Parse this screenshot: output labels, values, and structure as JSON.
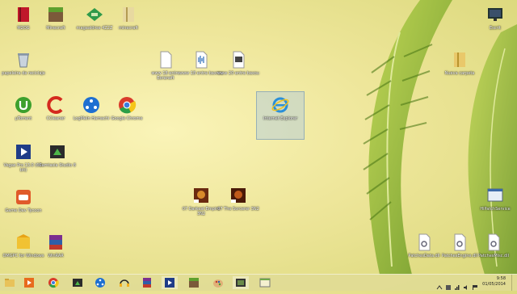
{
  "desktop": {
    "icons": [
      {
        "label": "M2OG"
      },
      {
        "label": "Minecraft"
      },
      {
        "label": "magaaldroe 4Z2Z"
      },
      {
        "label": "minecraft"
      },
      {
        "label": "Escrit"
      },
      {
        "label": "papeleira de reciclaje"
      },
      {
        "label": "www 18 entre Eoranaft"
      },
      {
        "label": "www 18 entre baxrou"
      },
      {
        "label": "www 20 entre baxou"
      },
      {
        "label": "Nueva carpeta"
      },
      {
        "label": "µTorrent"
      },
      {
        "label": "CCleaner"
      },
      {
        "label": "LogMeIn Hamachi"
      },
      {
        "label": "Google Chrome"
      },
      {
        "label": "Internet Explorer"
      },
      {
        "label": "Vegas Pro 13.0 (64-bit)"
      },
      {
        "label": "Camtasia Studio 8"
      },
      {
        "label": "07 Darkest Empire 3N2"
      },
      {
        "label": "07 The Sorcerer 3N2"
      },
      {
        "label": "HiPatchService"
      },
      {
        "label": "Game Dev Tycoon"
      },
      {
        "label": "OMGPC for Windows"
      },
      {
        "label": "WinRAR"
      },
      {
        "label": "PatchesData.dll"
      },
      {
        "label": "PatchesEngine.dll"
      },
      {
        "label": "PatchesMisc.dll"
      }
    ]
  },
  "taskbar": {
    "time": "9:58",
    "date": "01/05/2014"
  },
  "colors": {
    "background": "#f0e9a6",
    "leaf": "#7fae2e",
    "taskbar": "#e1dc96",
    "selection": "#aac8e1"
  }
}
